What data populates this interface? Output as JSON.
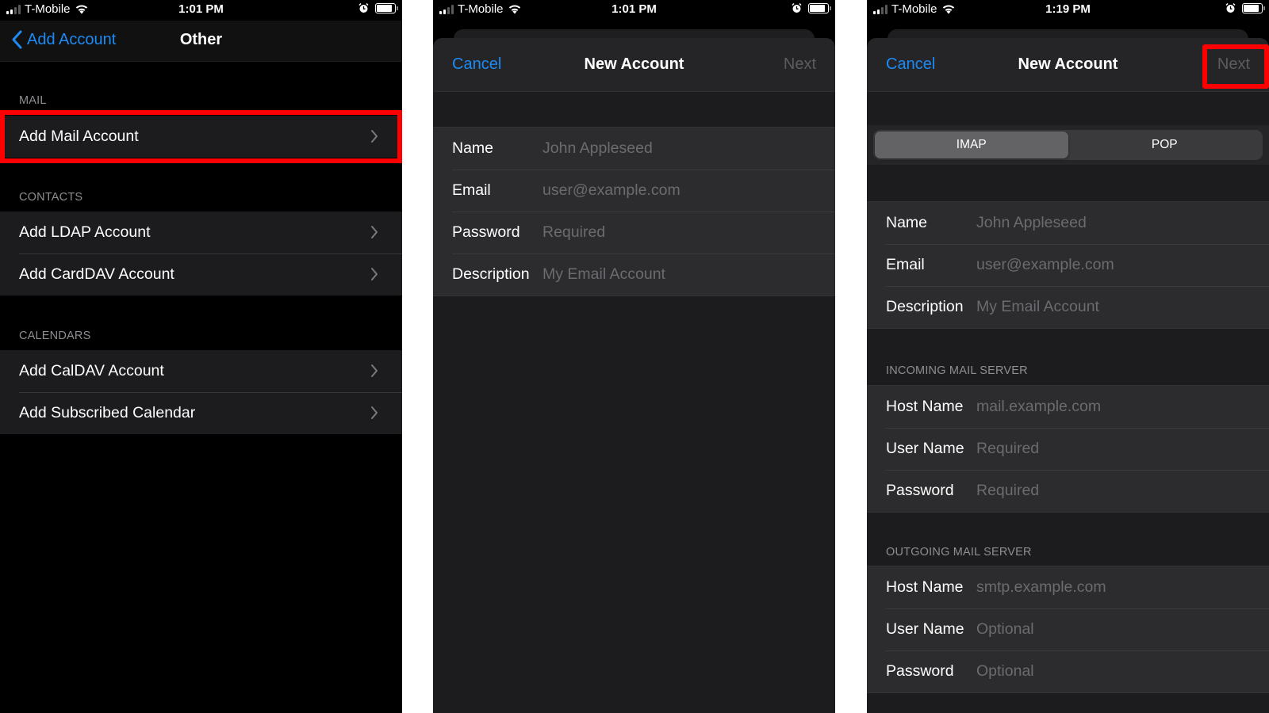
{
  "colors": {
    "accent": "#1d8bf5",
    "highlight": "#ff0000",
    "disabled": "#5c5c60",
    "placeholder": "#6b6b70",
    "section_label": "#8e8e93"
  },
  "panels": [
    {
      "status": {
        "carrier": "T-Mobile",
        "time": "1:01 PM"
      },
      "nav": {
        "back_label": "Add Account",
        "title": "Other"
      },
      "sections": [
        {
          "header": "MAIL",
          "items": [
            {
              "label": "Add Mail Account",
              "highlighted": true
            }
          ]
        },
        {
          "header": "CONTACTS",
          "items": [
            {
              "label": "Add LDAP Account"
            },
            {
              "label": "Add CardDAV Account"
            }
          ]
        },
        {
          "header": "CALENDARS",
          "items": [
            {
              "label": "Add CalDAV Account"
            },
            {
              "label": "Add Subscribed Calendar"
            }
          ]
        }
      ]
    },
    {
      "status": {
        "carrier": "T-Mobile",
        "time": "1:01 PM"
      },
      "nav": {
        "cancel_label": "Cancel",
        "title": "New Account",
        "next_label": "Next"
      },
      "fields": [
        {
          "label": "Name",
          "placeholder": "John Appleseed"
        },
        {
          "label": "Email",
          "placeholder": "user@example.com"
        },
        {
          "label": "Password",
          "placeholder": "Required"
        },
        {
          "label": "Description",
          "placeholder": "My Email Account"
        }
      ]
    },
    {
      "status": {
        "carrier": "T-Mobile",
        "time": "1:19 PM"
      },
      "nav": {
        "cancel_label": "Cancel",
        "title": "New Account",
        "next_label": "Next",
        "next_highlighted": true
      },
      "segmented": {
        "options": [
          "IMAP",
          "POP"
        ],
        "selected": "IMAP"
      },
      "fields": [
        {
          "label": "Name",
          "placeholder": "John Appleseed"
        },
        {
          "label": "Email",
          "placeholder": "user@example.com"
        },
        {
          "label": "Description",
          "placeholder": "My Email Account"
        }
      ],
      "incoming": {
        "header": "INCOMING MAIL SERVER",
        "fields": [
          {
            "label": "Host Name",
            "placeholder": "mail.example.com"
          },
          {
            "label": "User Name",
            "placeholder": "Required"
          },
          {
            "label": "Password",
            "placeholder": "Required"
          }
        ]
      },
      "outgoing": {
        "header": "OUTGOING MAIL SERVER",
        "fields": [
          {
            "label": "Host Name",
            "placeholder": "smtp.example.com"
          },
          {
            "label": "User Name",
            "placeholder": "Optional"
          },
          {
            "label": "Password",
            "placeholder": "Optional"
          }
        ]
      }
    }
  ]
}
